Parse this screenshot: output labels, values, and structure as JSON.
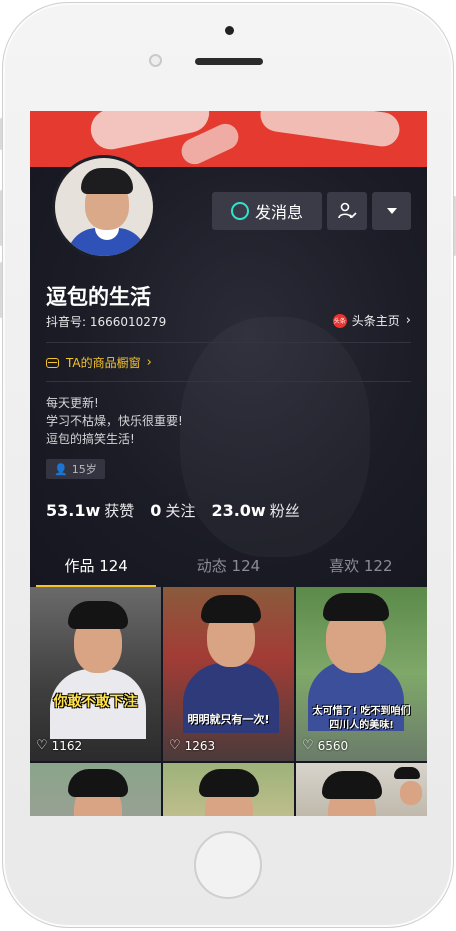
{
  "colors": {
    "accent": "#f5c32c",
    "chat_icon": "#30e3cf",
    "background": "#161722",
    "button": "#3a3b46"
  },
  "profile": {
    "nickname": "逗包的生活",
    "douyin_id": "抖音号: 1666010279",
    "toutiao_logo_text": "头条",
    "toutiao_link": "头条主页",
    "shop_window": "TA的商品橱窗",
    "bio": [
      "每天更新!",
      "学习不枯燥，快乐很重要!",
      "逗包的搞笑生活!"
    ],
    "age_tag": "15岁"
  },
  "actions": {
    "message_label": "发消息"
  },
  "stats": [
    {
      "value": "53.1w",
      "label": "获赞"
    },
    {
      "value": "0",
      "label": "关注"
    },
    {
      "value": "23.0w",
      "label": "粉丝"
    }
  ],
  "tabs": [
    {
      "label": "作品 124",
      "active": true
    },
    {
      "label": "动态 124",
      "active": false
    },
    {
      "label": "喜欢 122",
      "active": false
    }
  ],
  "videos": [
    {
      "caption": "你敢不敢下注",
      "likes": "1162"
    },
    {
      "caption": "明明就只有一次!",
      "likes": "1263"
    },
    {
      "caption_line1": "太可惜了! 吃不到咱们",
      "caption_line2": "四川人的美味!",
      "likes": "6560"
    }
  ],
  "icons": {
    "chat": "chat-bubble-icon",
    "follow": "user-check-icon",
    "more": "triangle-down-icon",
    "chevron": "chevron-right-icon",
    "shop": "shop-window-icon",
    "person": "person-icon",
    "heart": "heart-icon"
  }
}
